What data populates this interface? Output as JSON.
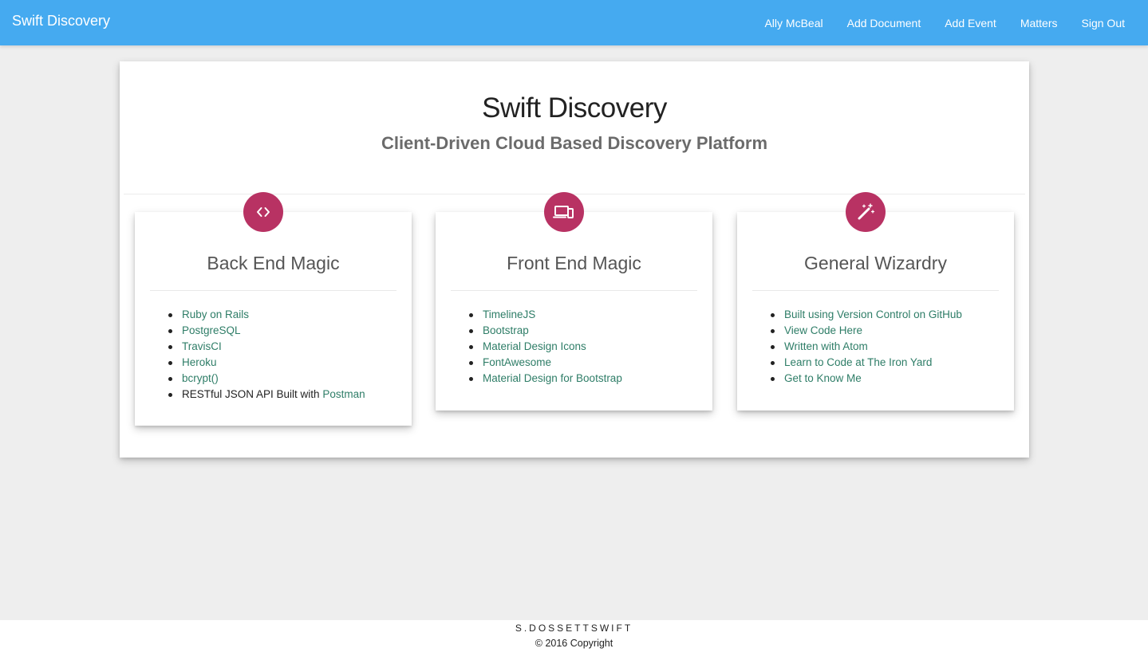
{
  "navbar": {
    "brand": "Swift Discovery",
    "links": [
      "Ally McBeal",
      "Add Document",
      "Add Event",
      "Matters",
      "Sign Out"
    ],
    "background": "#45aaf0"
  },
  "hero": {
    "title": "Swift Discovery",
    "subtitle": "Client-Driven Cloud Based Discovery Platform"
  },
  "features": [
    {
      "icon": "code-icon",
      "title": "Back End Magic",
      "items": [
        {
          "link": "Ruby on Rails"
        },
        {
          "link": "PostgreSQL"
        },
        {
          "link": "TravisCI"
        },
        {
          "link": "Heroku"
        },
        {
          "link": "bcrypt()"
        },
        {
          "prefix": "RESTful JSON API Built with ",
          "link": "Postman"
        }
      ]
    },
    {
      "icon": "devices-icon",
      "title": "Front End Magic",
      "items": [
        {
          "link": "TimelineJS"
        },
        {
          "link": "Bootstrap"
        },
        {
          "link": "Material Design Icons"
        },
        {
          "link": "FontAwesome"
        },
        {
          "link": "Material Design for Bootstrap"
        }
      ]
    },
    {
      "icon": "magic-wand-icon",
      "title": "General Wizardry",
      "items": [
        {
          "link": "Built using Version Control on GitHub"
        },
        {
          "link": "View Code Here"
        },
        {
          "link": "Written with Atom"
        },
        {
          "link": "Learn to Code at The Iron Yard"
        },
        {
          "link": "Get to Know Me"
        }
      ]
    }
  ],
  "colors": {
    "accent": "#b83263",
    "link": "#2e7d67"
  },
  "footer": {
    "brand": "S.DOSSETTSWIFT",
    "copyright": "© 2016 Copyright"
  }
}
